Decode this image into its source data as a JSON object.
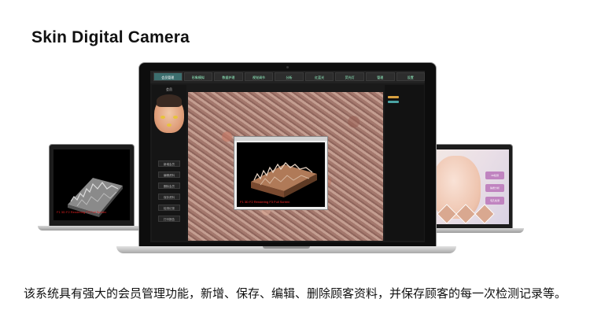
{
  "heading": "Skin Digital Camera",
  "caption": "该系统具有强大的会员管理功能，新增、保存、编辑、删除顾客资料，并保存顾客的每一次检测记录等。",
  "main_app": {
    "tabs": [
      "会员管理",
      "形象模拟",
      "数据护理",
      "视觉调节",
      "分析",
      "红蓝光",
      "荧光灯",
      "管理",
      "设置"
    ],
    "active_tab": 0,
    "left_panel_title": "会员",
    "left_panel_buttons": [
      "新增会员",
      "编辑资料",
      "删除会员",
      "保存资料",
      "检测记录",
      "打印报告"
    ],
    "render_hint": "F1 3D  F2 Rendering  F3 Full Screen"
  },
  "left_screen": {
    "render_hint": "F1 3D  F2 Rendering  F3 Full Screen"
  },
  "right_screen": {
    "badges": [
      "3D检测",
      "肤质分析",
      "毛孔检测"
    ]
  }
}
